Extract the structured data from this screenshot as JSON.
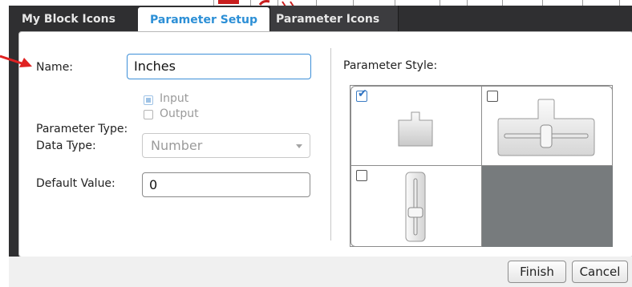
{
  "tabs": [
    {
      "label": "My Block Icons",
      "active": false
    },
    {
      "label": "Parameter Setup",
      "active": true
    },
    {
      "label": "Parameter Icons",
      "active": false
    }
  ],
  "form": {
    "name_label": "Name:",
    "name_value": "Inches",
    "parameter_type_label": "Parameter Type:",
    "parameter_type_options": [
      {
        "label": "Input",
        "selected": true
      },
      {
        "label": "Output",
        "selected": false
      }
    ],
    "data_type_label": "Data Type:",
    "data_type_value": "Number",
    "default_value_label": "Default Value:",
    "default_value": "0"
  },
  "parameter_style": {
    "label": "Parameter Style:",
    "options": [
      {
        "icon": "parameter-box-icon",
        "checked": true
      },
      {
        "icon": "horizontal-slider-icon",
        "checked": false
      },
      {
        "icon": "vertical-slider-icon",
        "checked": false
      }
    ]
  },
  "footer": {
    "finish_label": "Finish",
    "cancel_label": "Cancel"
  },
  "colors": {
    "active_tab_text": "#2c8fd6",
    "dark_frame": "#2f2f31",
    "annotation_red": "#c81e1e"
  }
}
